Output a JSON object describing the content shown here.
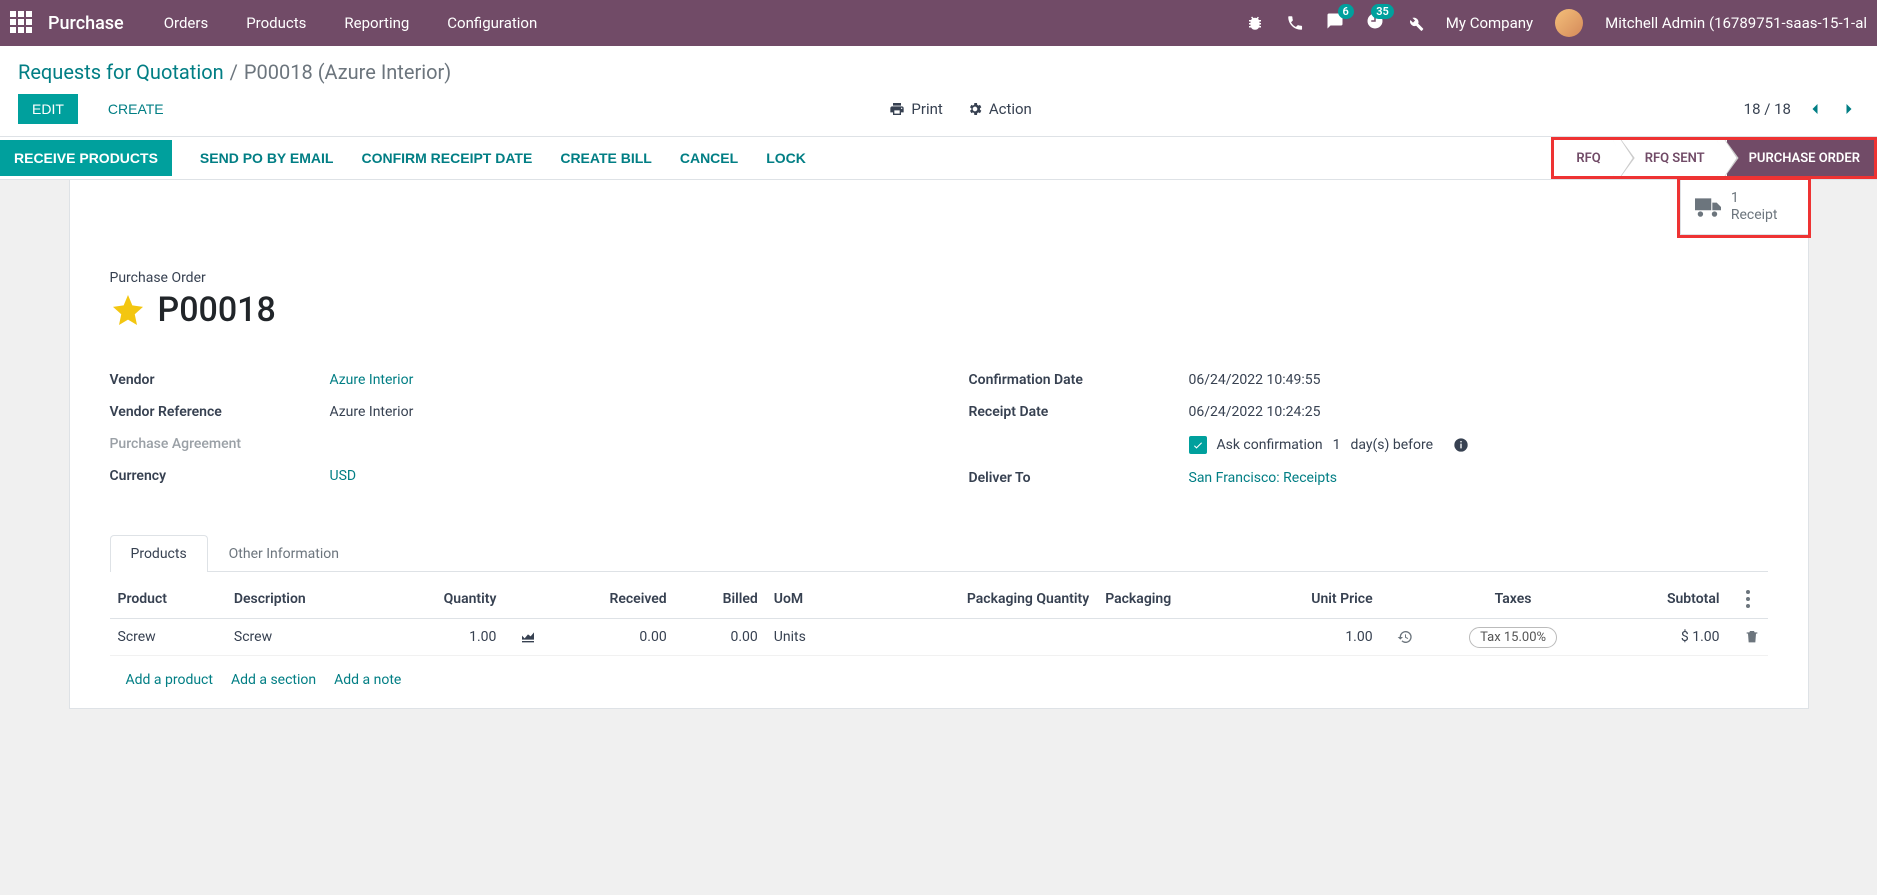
{
  "app": {
    "title": "Purchase"
  },
  "nav": {
    "items": [
      "Orders",
      "Products",
      "Reporting",
      "Configuration"
    ]
  },
  "topbar": {
    "msg_badge": "6",
    "activity_badge": "35",
    "company": "My Company",
    "user": "Mitchell Admin (16789751-saas-15-1-al"
  },
  "breadcrumb": {
    "parent": "Requests for Quotation",
    "current": "P00018 (Azure Interior)"
  },
  "cp": {
    "edit": "Edit",
    "create": "Create",
    "print": "Print",
    "action": "Action",
    "pager": "18 / 18"
  },
  "actions": {
    "receive": "Receive Products",
    "send": "Send PO by Email",
    "confirm": "Confirm Receipt Date",
    "bill": "Create Bill",
    "cancel": "Cancel",
    "lock": "Lock"
  },
  "stages": {
    "rfq": "RFQ",
    "sent": "RFQ Sent",
    "po": "Purchase Order"
  },
  "stat": {
    "count": "1",
    "label": "Receipt"
  },
  "header": {
    "label": "Purchase Order",
    "name": "P00018"
  },
  "left": {
    "vendor_label": "Vendor",
    "vendor": "Azure Interior",
    "ref_label": "Vendor Reference",
    "ref": "Azure Interior",
    "agreement_label": "Purchase Agreement",
    "currency_label": "Currency",
    "currency": "USD"
  },
  "right": {
    "conf_label": "Confirmation Date",
    "conf": "06/24/2022 10:49:55",
    "receipt_label": "Receipt Date",
    "receipt": "06/24/2022 10:24:25",
    "ask_prefix": "Ask confirmation",
    "ask_days": "1",
    "ask_suffix": "day(s) before",
    "deliver_label": "Deliver To",
    "deliver": "San Francisco: Receipts"
  },
  "tabs": {
    "products": "Products",
    "other": "Other Information"
  },
  "table": {
    "headers": {
      "product": "Product",
      "desc": "Description",
      "qty": "Quantity",
      "recv": "Received",
      "billed": "Billed",
      "uom": "UoM",
      "packqty": "Packaging Quantity",
      "pack": "Packaging",
      "price": "Unit Price",
      "taxes": "Taxes",
      "subtotal": "Subtotal"
    },
    "row": {
      "product": "Screw",
      "desc": "Screw",
      "qty": "1.00",
      "recv": "0.00",
      "billed": "0.00",
      "uom": "Units",
      "price": "1.00",
      "tax": "Tax 15.00%",
      "subtotal": "$ 1.00"
    },
    "add": {
      "product": "Add a product",
      "section": "Add a section",
      "note": "Add a note"
    }
  }
}
